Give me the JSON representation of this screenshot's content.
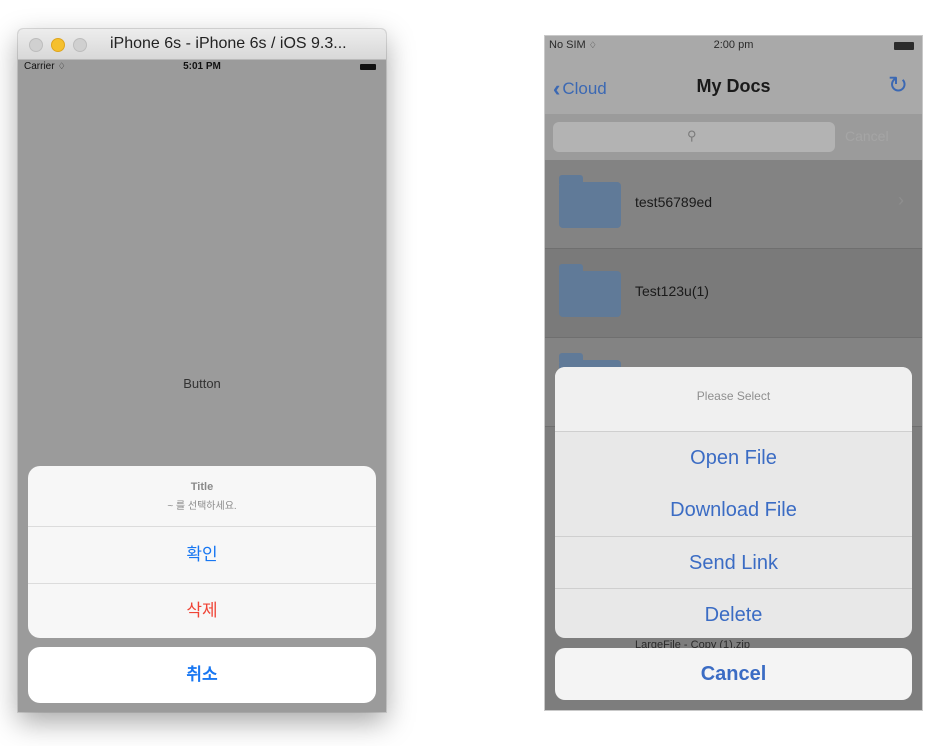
{
  "left_window": {
    "title": "iPhone 6s - iPhone 6s / iOS 9.3...",
    "status": {
      "carrier": "Carrier",
      "time": "5:01 PM"
    },
    "button_label": "Button",
    "action_sheet": {
      "title": "Title",
      "message": "~ 를 선택하세요.",
      "confirm": "확인",
      "delete": "삭제",
      "cancel": "취소"
    },
    "colors": {
      "action_blue": "#1877f2",
      "destructive_red": "#f04436"
    }
  },
  "right_phone": {
    "status": {
      "carrier": "No SIM",
      "time": "2:00 pm"
    },
    "nav": {
      "back_label": "Cloud",
      "title": "My Docs"
    },
    "search": {
      "cancel": "Cancel"
    },
    "rows": [
      {
        "label": "test56789ed"
      },
      {
        "label": "Test123u(1)"
      }
    ],
    "behind_text": "LargeFile - Copy (1).zip",
    "action_sheet": {
      "title": "Please Select",
      "options": [
        "Open File",
        "Download File",
        "Send Link",
        "Delete"
      ],
      "cancel": "Cancel"
    },
    "colors": {
      "tint_blue": "#3b6cc4"
    }
  }
}
